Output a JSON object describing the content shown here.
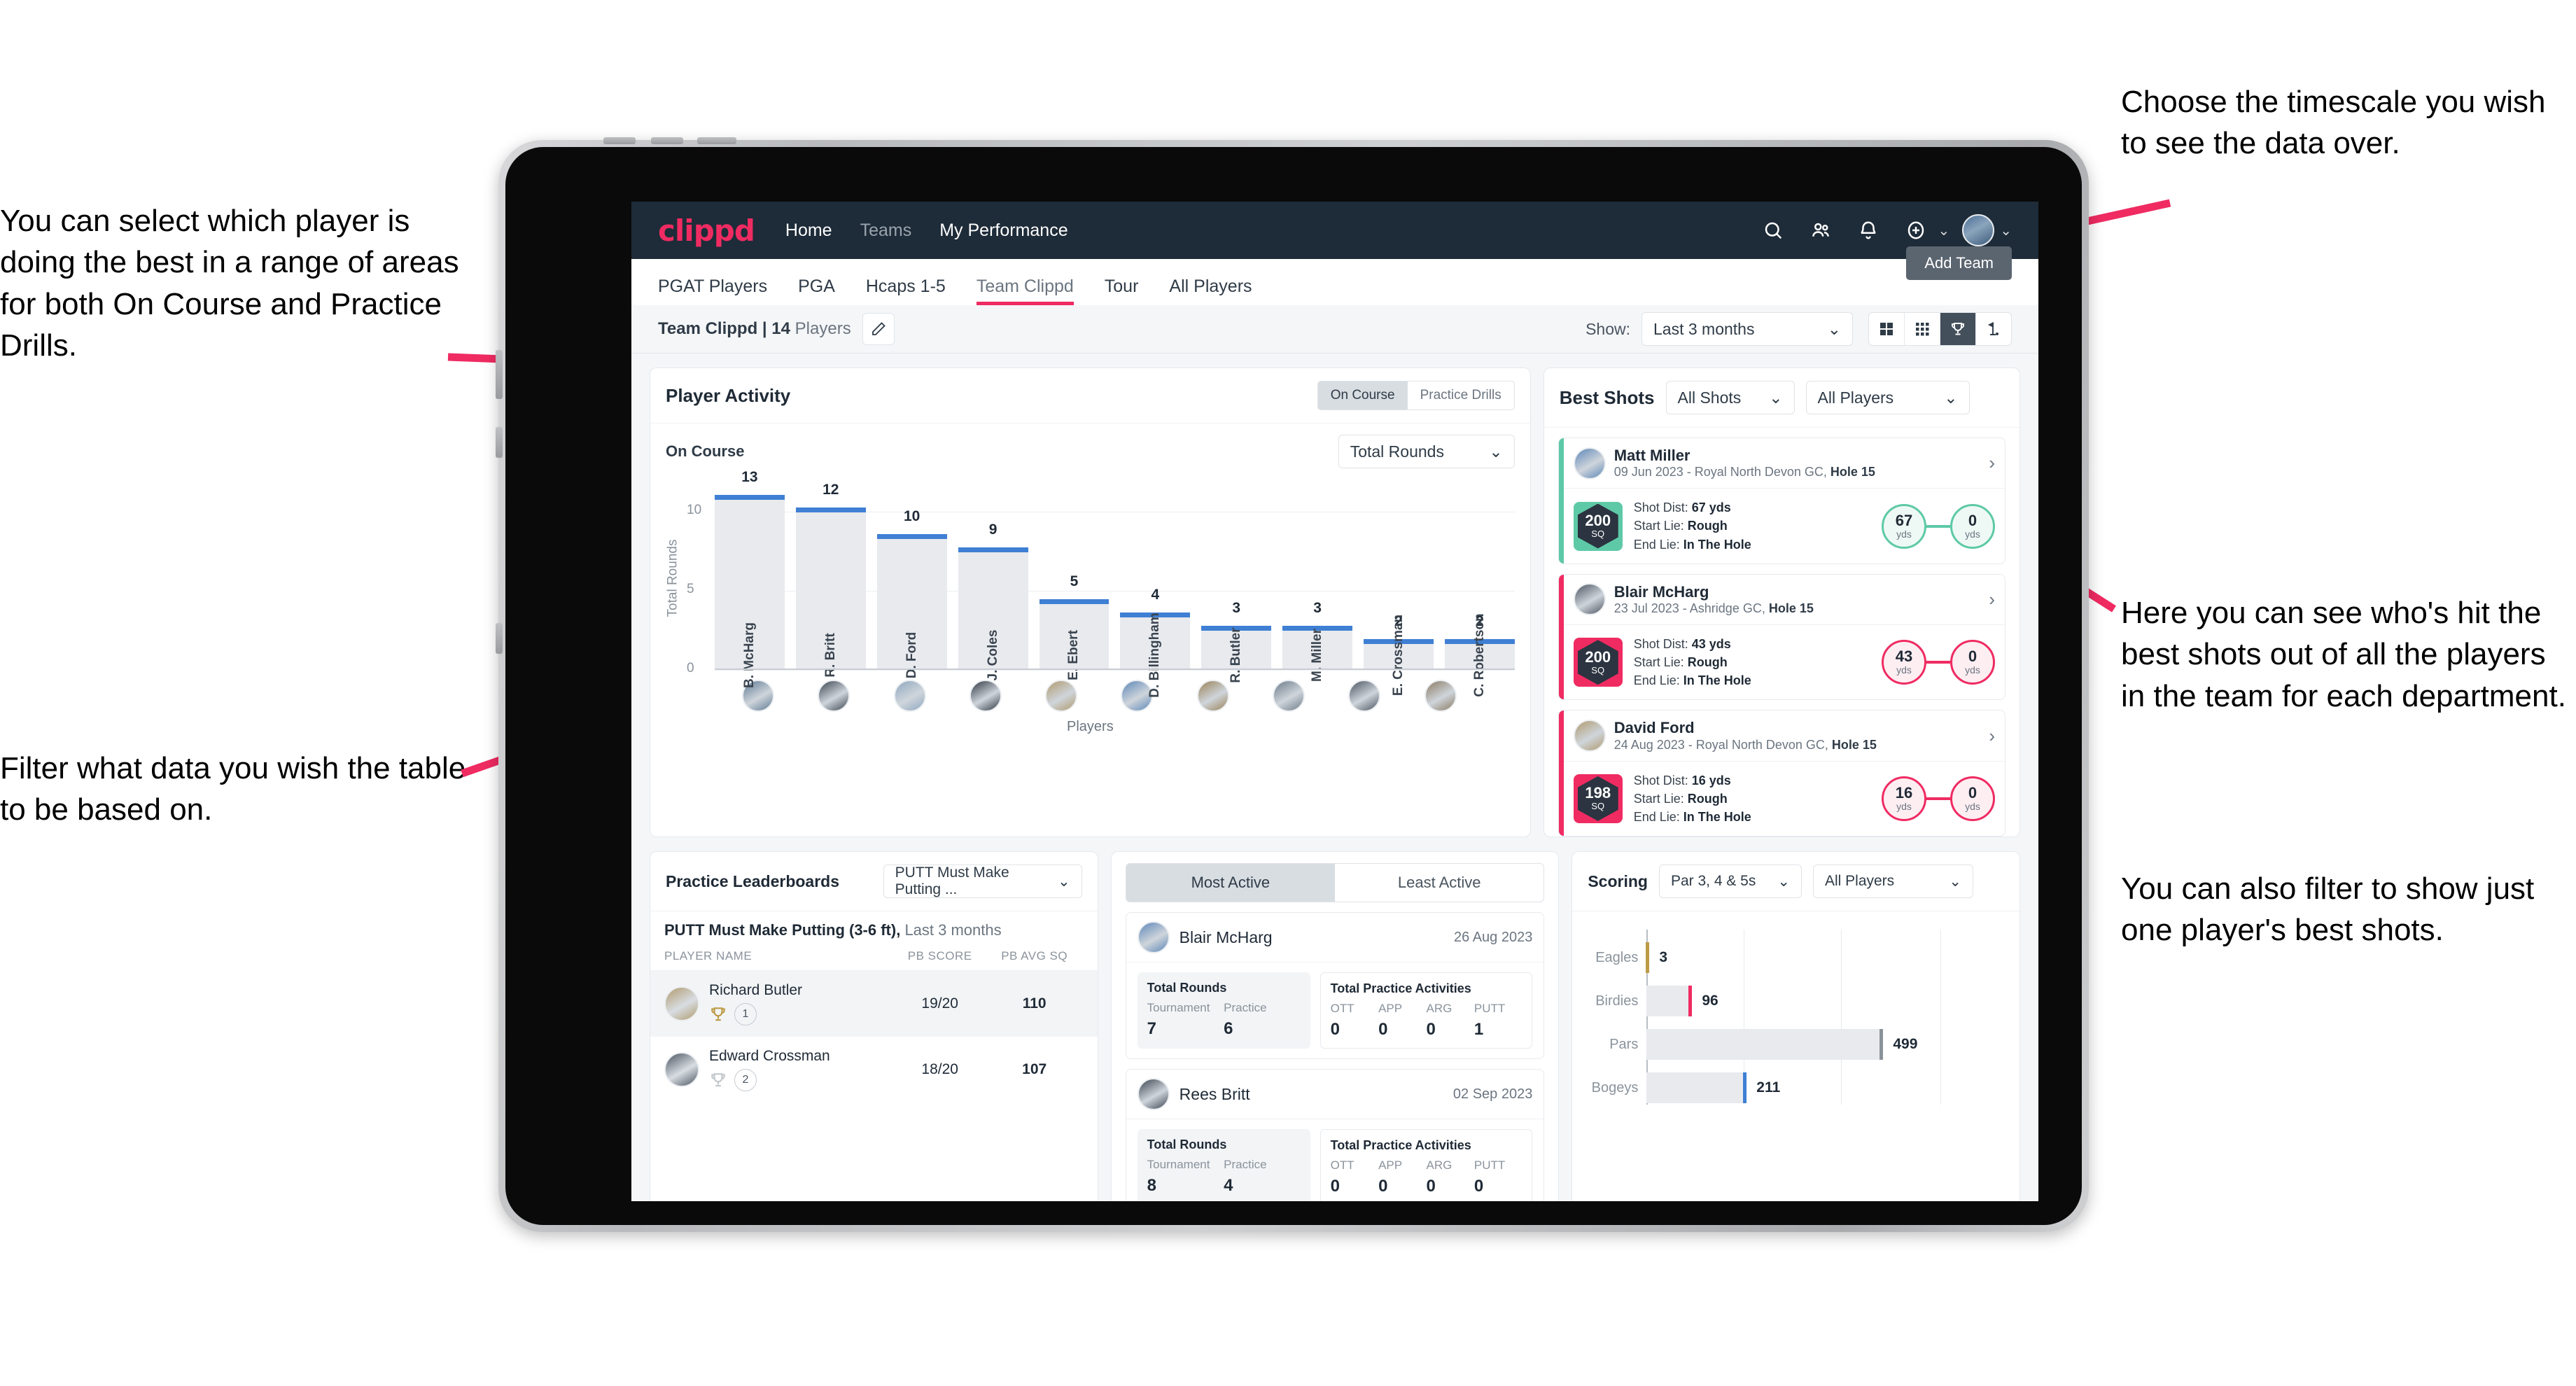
{
  "annotations": {
    "left_top": "You can select which player is doing the best in a range of areas for both On Course and Practice Drills.",
    "left_bottom": "Filter what data you wish the table to be based on.",
    "right_top": "Choose the timescale you wish to see the data over.",
    "right_mid": "Here you can see who's hit the best shots out of all the players in the team for each department.",
    "right_bottom": "You can also filter to show just one player's best shots."
  },
  "topnav": {
    "logo": "clippd",
    "links": [
      {
        "label": "Home",
        "active": true
      },
      {
        "label": "Teams",
        "active": false
      },
      {
        "label": "My Performance",
        "active": true
      }
    ],
    "icons": [
      "search-icon",
      "people-icon",
      "bell-icon",
      "plus-circle-icon",
      "avatar-icon"
    ]
  },
  "tabs": {
    "items": [
      "PGAT Players",
      "PGA",
      "Hcaps 1-5",
      "Team Clippd",
      "Tour",
      "All Players"
    ],
    "active": "Team Clippd",
    "add_team_label": "Add Team"
  },
  "subbar": {
    "team_name": "Team Clippd",
    "separator": " | ",
    "player_count": "14",
    "players_word": " Players",
    "edit_icon": "pencil-icon",
    "show_label": "Show:",
    "timescale_value": "Last 3 months",
    "view_modes": [
      "grid-large-icon",
      "grid-small-icon",
      "trophy-icon",
      "flag-icon"
    ],
    "active_view": "trophy-icon"
  },
  "player_activity": {
    "title": "Player Activity",
    "segments": [
      "On Course",
      "Practice Drills"
    ],
    "active_segment": "On Course",
    "sub_label": "On Course",
    "metric_select": "Total Rounds",
    "x_axis_label": "Players"
  },
  "chart_data": [
    {
      "type": "bar",
      "title": "Player Activity — On Course",
      "categories": [
        "B. McHarg",
        "R. Britt",
        "D. Ford",
        "J. Coles",
        "E. Ebert",
        "D. Billingham",
        "R. Butler",
        "M. Miller",
        "E. Crossman",
        "C. Robertson"
      ],
      "values": [
        13,
        12,
        10,
        9,
        5,
        4,
        3,
        3,
        2,
        2
      ],
      "xlabel": "Players",
      "ylabel": "Total Rounds",
      "ylim": [
        0,
        14
      ],
      "yticks": [
        0,
        5,
        10
      ],
      "grid": true,
      "bar_color": "#e8eaee",
      "cap_color": "#3f7fd4"
    },
    {
      "type": "bar",
      "orientation": "horizontal",
      "title": "Scoring",
      "categories": [
        "Eagles",
        "Birdies",
        "Pars",
        "Bogeys"
      ],
      "values": [
        3,
        96,
        499,
        211
      ],
      "xlim": [
        0,
        620
      ],
      "grid": true,
      "colors": [
        "#bd9b45",
        "#ef2b62",
        "#8a939c",
        "#3f7fd4"
      ]
    }
  ],
  "best_shots": {
    "title": "Best Shots",
    "shot_filter": "All Shots",
    "player_filter": "All Players",
    "cards": [
      {
        "name": "Matt Miller",
        "meta_date": "09 Jun 2023",
        "meta_course": " - Royal North Devon GC, ",
        "meta_hole": "Hole 15",
        "sq_value": "200",
        "sq_unit": "SQ",
        "shot_dist_label": "Shot Dist: ",
        "shot_dist": "67 yds",
        "start_lie_label": "Start Lie: ",
        "start_lie": "Rough",
        "end_lie_label": "End Lie: ",
        "end_lie": "In The Hole",
        "from_value": "67",
        "from_unit": "yds",
        "to_value": "0",
        "to_unit": "yds",
        "accent": "#5ec9a7"
      },
      {
        "name": "Blair McHarg",
        "meta_date": "23 Jul 2023",
        "meta_course": " - Ashridge GC, ",
        "meta_hole": "Hole 15",
        "sq_value": "200",
        "sq_unit": "SQ",
        "shot_dist_label": "Shot Dist: ",
        "shot_dist": "43 yds",
        "start_lie_label": "Start Lie: ",
        "start_lie": "Rough",
        "end_lie_label": "End Lie: ",
        "end_lie": "In The Hole",
        "from_value": "43",
        "from_unit": "yds",
        "to_value": "0",
        "to_unit": "yds",
        "accent": "#ef2b62"
      },
      {
        "name": "David Ford",
        "meta_date": "24 Aug 2023",
        "meta_course": " - Royal North Devon GC, ",
        "meta_hole": "Hole 15",
        "sq_value": "198",
        "sq_unit": "SQ",
        "shot_dist_label": "Shot Dist: ",
        "shot_dist": "16 yds",
        "start_lie_label": "Start Lie: ",
        "start_lie": "Rough",
        "end_lie_label": "End Lie: ",
        "end_lie": "In The Hole",
        "from_value": "16",
        "from_unit": "yds",
        "to_value": "0",
        "to_unit": "yds",
        "accent": "#ef2b62"
      }
    ]
  },
  "practice_leaderboards": {
    "title": "Practice Leaderboards",
    "drill_select": "PUTT Must Make Putting ...",
    "subtitle_bold": "PUTT Must Make Putting (3-6 ft),",
    "subtitle_muted": " Last 3 months",
    "columns": [
      "PLAYER NAME",
      "PB SCORE",
      "PB AVG SQ"
    ],
    "rows": [
      {
        "name": "Richard Butler",
        "rank": "1",
        "trophy": "gold",
        "pb_score": "19/20",
        "pb_avg_sq": "110"
      },
      {
        "name": "Edward Crossman",
        "rank": "2",
        "trophy": "silver",
        "pb_score": "18/20",
        "pb_avg_sq": "107"
      }
    ]
  },
  "activity": {
    "tabs": [
      "Most Active",
      "Least Active"
    ],
    "active_tab": "Most Active",
    "rounds_title": "Total Rounds",
    "rounds_cols": [
      "Tournament",
      "Practice"
    ],
    "practice_title": "Total Practice Activities",
    "practice_cols": [
      "OTT",
      "APP",
      "ARG",
      "PUTT"
    ],
    "cards": [
      {
        "name": "Blair McHarg",
        "date": "26 Aug 2023",
        "tournament": "7",
        "practice": "6",
        "ott": "0",
        "app": "0",
        "arg": "0",
        "putt": "1"
      },
      {
        "name": "Rees Britt",
        "date": "02 Sep 2023",
        "tournament": "8",
        "practice": "4",
        "ott": "0",
        "app": "0",
        "arg": "0",
        "putt": "0"
      }
    ]
  },
  "scoring": {
    "title": "Scoring",
    "par_select": "Par 3, 4 & 5s",
    "player_select": "All Players"
  },
  "colors": {
    "brand_pink": "#ef2b62",
    "navy": "#1e2b38",
    "teal": "#5ec9a7",
    "blue": "#3f7fd4",
    "gold": "#bd9b45"
  }
}
